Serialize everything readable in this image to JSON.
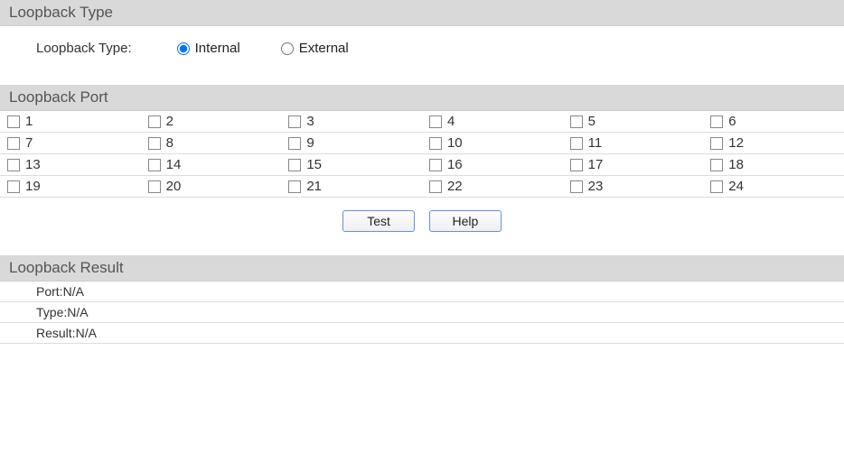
{
  "loopback_type": {
    "header": "Loopback Type",
    "label": "Loopback Type:",
    "options": {
      "internal": "Internal",
      "external": "External"
    },
    "selected": "internal"
  },
  "loopback_port": {
    "header": "Loopback Port",
    "ports": [
      "1",
      "2",
      "3",
      "4",
      "5",
      "6",
      "7",
      "8",
      "9",
      "10",
      "11",
      "12",
      "13",
      "14",
      "15",
      "16",
      "17",
      "18",
      "19",
      "20",
      "21",
      "22",
      "23",
      "24"
    ]
  },
  "buttons": {
    "test": "Test",
    "help": "Help"
  },
  "loopback_result": {
    "header": "Loopback Result",
    "rows": {
      "port_label": "Port:",
      "port_value": "N/A",
      "type_label": "Type:",
      "type_value": "N/A",
      "result_label": "Result:",
      "result_value": "N/A"
    }
  }
}
